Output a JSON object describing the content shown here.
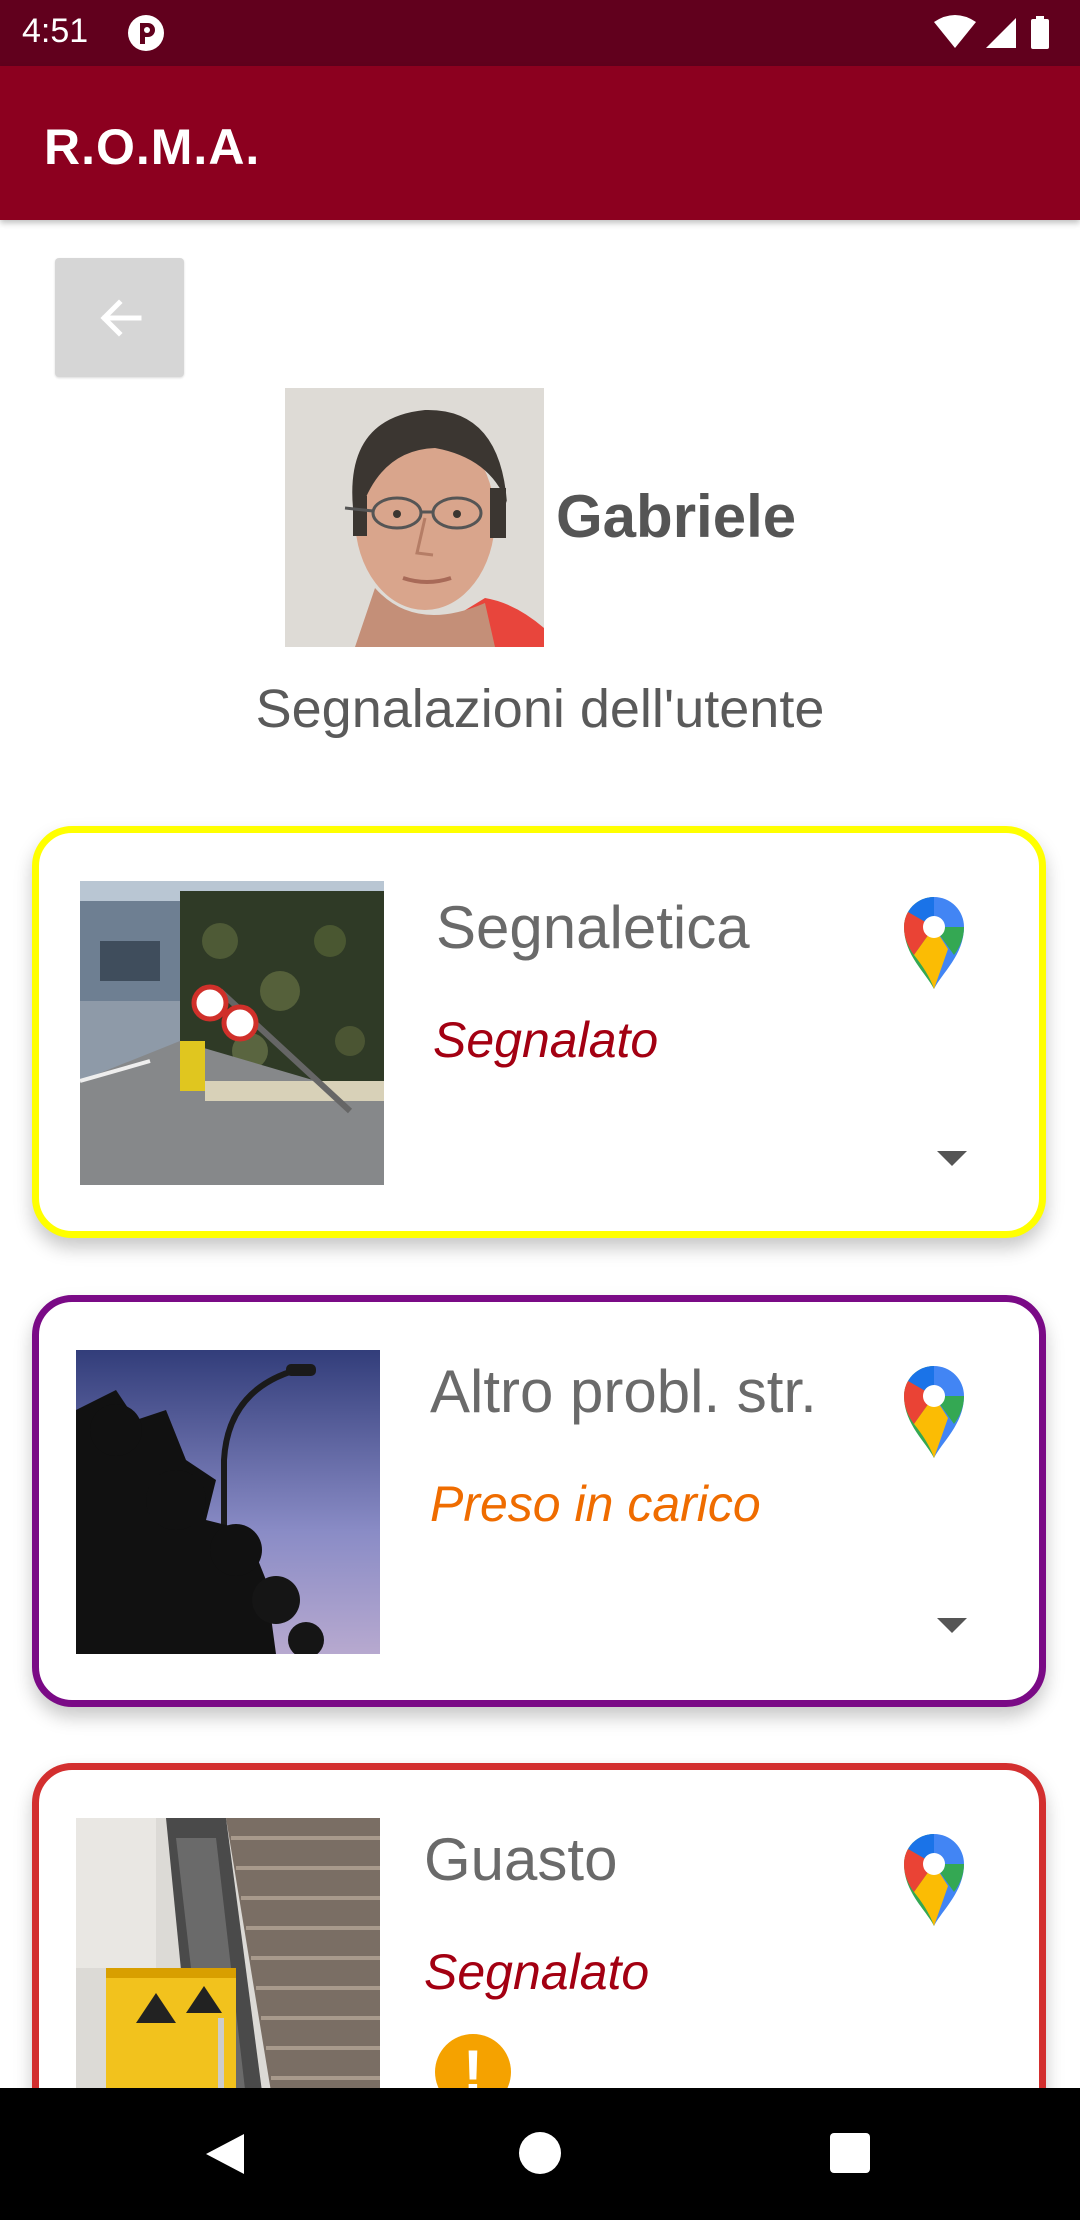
{
  "status_bar": {
    "time": "4:51"
  },
  "app_bar": {
    "title": "R.O.M.A."
  },
  "profile": {
    "name": "Gabriele",
    "section_title": "Segnalazioni dell'utente"
  },
  "reports": [
    {
      "category": "Segnaletica",
      "status": "Segnalato",
      "border_color": "#ffff00",
      "status_color": "#a30012",
      "image": "photo-damaged-speed-limit-signs-by-hedge",
      "has_warning": false
    },
    {
      "category": "Altro probl. str.",
      "status": "Preso in carico",
      "border_color": "#7a0a86",
      "status_color": "#ef6c00",
      "image": "photo-street-lamp-at-dusk",
      "has_warning": false
    },
    {
      "category": "Guasto",
      "status": "Segnalato",
      "border_color": "#d32f2f",
      "status_color": "#a30012",
      "image": "photo-escalator-with-yellow-barrier",
      "has_warning": true
    }
  ],
  "colors": {
    "status_bar": "#61001d",
    "app_bar": "#8c001f",
    "nav_bar": "#000000"
  }
}
